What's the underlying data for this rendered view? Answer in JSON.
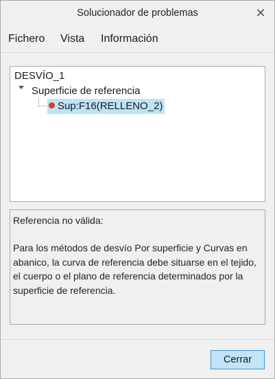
{
  "window": {
    "title": "Solucionador de problemas",
    "close_glyph": "✕"
  },
  "menu": {
    "items": [
      "Fichero",
      "Vista",
      "Información"
    ]
  },
  "tree": {
    "root": "DESVÍO_1",
    "node": "Superficie de referencia",
    "leaf": "Sup:F16(RELLENO_2)",
    "leaf_status_color": "#e23a2d",
    "leaf_selected": true
  },
  "message": {
    "heading": "Referencia no válida:",
    "body": "Para los métodos de desvío Por superficie y Curvas en abanico, la curva de referencia debe situarse en el tejido, el cuerpo o el plano de referencia determinados por la superficie de referencia."
  },
  "footer": {
    "close_button_label": "Cerrar"
  },
  "colors": {
    "accent": "#3c93d1",
    "selection": "#bde3f7",
    "button_fill": "#c3e4f7"
  }
}
